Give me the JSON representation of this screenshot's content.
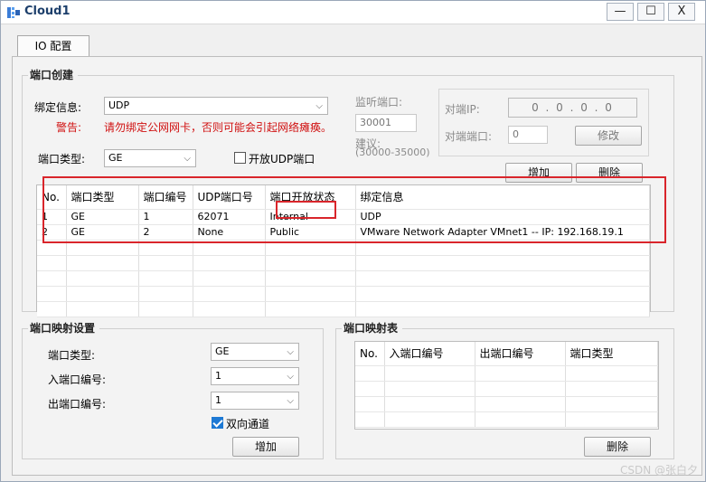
{
  "window": {
    "title": "Cloud1",
    "controls": {
      "minimize": "—",
      "maximize": "☐",
      "close": "X"
    }
  },
  "tabs": [
    {
      "label": "IO 配置",
      "active": true
    }
  ],
  "port_create": {
    "title": "端口创建",
    "bind_label": "绑定信息:",
    "bind_value": "UDP",
    "warning_label": "警告:",
    "warning_text": "请勿绑定公网网卡，否则可能会引起网络瘫痪。",
    "port_type_label": "端口类型:",
    "port_type_value": "GE",
    "open_udp_label": "开放UDP端口",
    "open_udp_checked": false,
    "listen_port_label": "监听端口:",
    "listen_port_value": "30001",
    "suggest_label": "建议:",
    "suggest_range": "(30000-35000)",
    "peer_ip_label": "对端IP:",
    "peer_ip_value": "0 . 0 . 0 . 0",
    "peer_port_label": "对端端口:",
    "peer_port_value": "0",
    "modify_button": "修改",
    "add_button": "增加",
    "delete_button": "删除",
    "table": {
      "columns": [
        "No.",
        "端口类型",
        "端口编号",
        "UDP端口号",
        "端口开放状态",
        "绑定信息"
      ],
      "rows": [
        [
          "1",
          "GE",
          "1",
          "62071",
          "Internal",
          "UDP"
        ],
        [
          "2",
          "GE",
          "2",
          "None",
          "Public",
          "VMware Network Adapter VMnet1 -- IP: 192.168.19.1"
        ]
      ]
    }
  },
  "port_map_settings": {
    "title": "端口映射设置",
    "port_type_label": "端口类型:",
    "port_type_value": "GE",
    "in_port_label": "入端口编号:",
    "in_port_value": "1",
    "out_port_label": "出端口编号:",
    "out_port_value": "1",
    "bidirectional_label": "双向通道",
    "bidirectional_checked": true,
    "add_button": "增加"
  },
  "port_map_table": {
    "title": "端口映射表",
    "columns": [
      "No.",
      "入端口编号",
      "出端口编号",
      "端口类型"
    ],
    "delete_button": "删除"
  },
  "watermark": "CSDN @张白夕",
  "colors": {
    "highlight_border": "#d9252b",
    "warning_text": "#d01010",
    "title_text": "#1d3f6b"
  }
}
